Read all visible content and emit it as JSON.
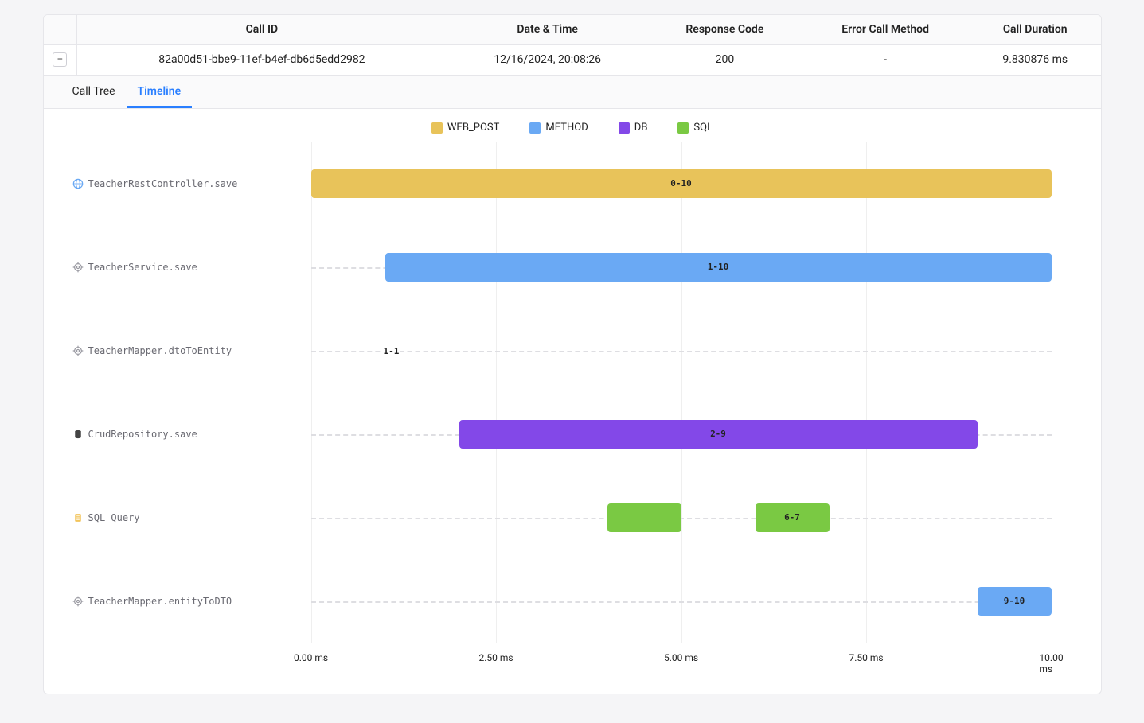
{
  "table": {
    "headers": [
      "Call ID",
      "Date & Time",
      "Response Code",
      "Error Call Method",
      "Call Duration"
    ],
    "row": {
      "call_id": "82a00d51-bbe9-11ef-b4ef-db6d5edd2982",
      "datetime": "12/16/2024, 20:08:26",
      "response_code": "200",
      "error_method": "-",
      "duration": "9.830876 ms"
    },
    "expand_glyph": "−"
  },
  "tabs": {
    "calltree": "Call Tree",
    "timeline": "Timeline",
    "active": "timeline"
  },
  "legend": [
    {
      "label": "WEB_POST",
      "color": "#e8c35a"
    },
    {
      "label": "METHOD",
      "color": "#6aa9f4"
    },
    {
      "label": "DB",
      "color": "#8348e8"
    },
    {
      "label": "SQL",
      "color": "#7ac943"
    }
  ],
  "chart_data": {
    "type": "bar",
    "xlabel": "ms",
    "xlim": [
      0,
      10
    ],
    "xticks": [
      "0.00 ms",
      "2.50 ms",
      "5.00 ms",
      "7.50 ms",
      "10.00 ms"
    ],
    "rows": [
      {
        "name": "TeacherRestController.save",
        "icon": "globe",
        "bars": [
          {
            "start": 0,
            "end": 10,
            "label": "0-10",
            "color": "#e8c35a"
          }
        ]
      },
      {
        "name": "TeacherService.save",
        "icon": "gear",
        "bars": [
          {
            "start": 1,
            "end": 10,
            "label": "1-10",
            "color": "#6aa9f4"
          }
        ]
      },
      {
        "name": "TeacherMapper.dtoToEntity",
        "icon": "gear",
        "bars": [
          {
            "start": 1,
            "end": 1,
            "label": "1-1",
            "color": "#6aa9f4",
            "label_out": true
          }
        ]
      },
      {
        "name": "CrudRepository.save",
        "icon": "db",
        "bars": [
          {
            "start": 2,
            "end": 9,
            "label": "2-9",
            "color": "#8348e8"
          }
        ]
      },
      {
        "name": "SQL Query",
        "icon": "sql",
        "bars": [
          {
            "start": 4,
            "end": 5,
            "label": "",
            "color": "#7ac943"
          },
          {
            "start": 6,
            "end": 7,
            "label": "6-7",
            "color": "#7ac943"
          }
        ]
      },
      {
        "name": "TeacherMapper.entityToDTO",
        "icon": "gear",
        "bars": [
          {
            "start": 9,
            "end": 10,
            "label": "9-10",
            "color": "#6aa9f4"
          }
        ]
      }
    ]
  }
}
